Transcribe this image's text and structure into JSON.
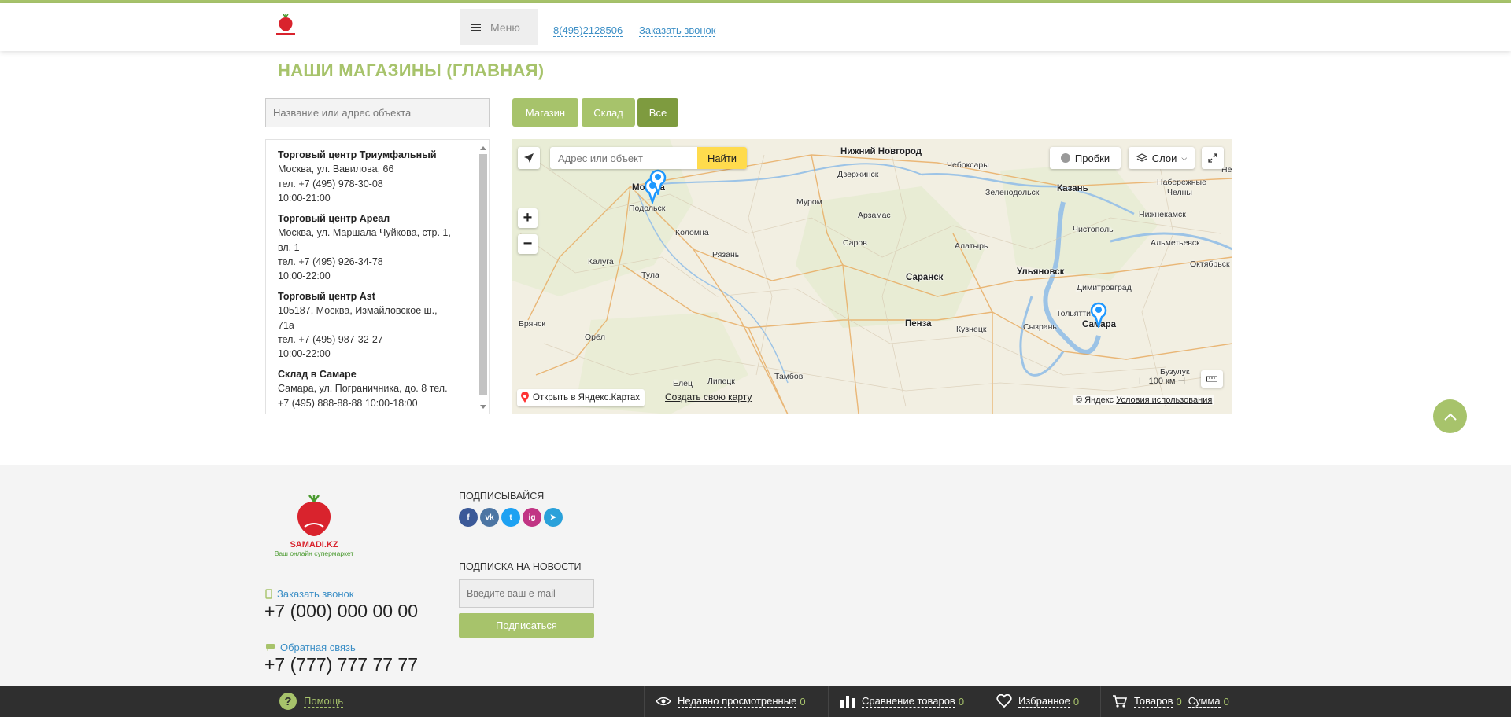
{
  "header": {
    "logo_text": "SAMADI.KZ",
    "menu_label": "Меню",
    "phone": "8(495)2128506",
    "callback": "Заказать звонок"
  },
  "page": {
    "title": "НАШИ МАГАЗИНЫ (ГЛАВНАЯ)",
    "search_placeholder": "Название или адрес объекта",
    "filters": [
      "Магазин",
      "Склад",
      "Все"
    ],
    "active_filter": "Все"
  },
  "stores": [
    {
      "name": "Торговый центр Триумфальный",
      "lines": [
        "Москва, ул. Вавилова, 66",
        "тел. +7 (495) 978-30-08",
        "10:00-21:00"
      ]
    },
    {
      "name": "Торговый центр Ареал",
      "lines": [
        "Москва, ул. Маршала Чуйкова, стр. 1,",
        "вл. 1",
        "тел. +7 (495) 926-34-78",
        "10:00-22:00"
      ]
    },
    {
      "name": "Торговый центр Ast",
      "lines": [
        "105187, Москва, Измайловское ш.,",
        "71а",
        "тел. +7 (495) 987-32-27",
        "10:00-22:00"
      ]
    },
    {
      "name": "Склад в Самаре",
      "lines": [
        "Самара, ул. Пограничника, до. 8 тел.",
        "+7 (495) 888-88-88 10:00-18:00"
      ]
    }
  ],
  "map": {
    "search_placeholder": "Адрес или объект",
    "find_label": "Найти",
    "traffic_label": "Пробки",
    "layers_label": "Слои",
    "open_label": "Открыть в Яндекс.Картах",
    "create_label": "Создать свою карту",
    "copyright": "© Яндекс",
    "terms": "Условия использования",
    "scale": "100 км",
    "cities": [
      {
        "name": "Нижний Новгород",
        "big": true
      },
      {
        "name": "Дзержинск"
      },
      {
        "name": "Чебоксары"
      },
      {
        "name": "Казань",
        "big": true
      },
      {
        "name": "Набережные"
      },
      {
        "name": "Челны"
      },
      {
        "name": "Нижнекамск"
      },
      {
        "name": "Зеленодольск"
      },
      {
        "name": "Муром"
      },
      {
        "name": "Арзамас"
      },
      {
        "name": "Чистополь"
      },
      {
        "name": "Альметьевск"
      },
      {
        "name": "Подольск"
      },
      {
        "name": "Коломна"
      },
      {
        "name": "Саров"
      },
      {
        "name": "Алатырь"
      },
      {
        "name": "Калуга"
      },
      {
        "name": "Рязань"
      },
      {
        "name": "Тула"
      },
      {
        "name": "Саранск",
        "big": true
      },
      {
        "name": "Ульяновск",
        "big": true
      },
      {
        "name": "Октябрьск"
      },
      {
        "name": "Димитровград"
      },
      {
        "name": "Тольятти"
      },
      {
        "name": "Самара",
        "big": true
      },
      {
        "name": "Брянск"
      },
      {
        "name": "Пенза",
        "big": true
      },
      {
        "name": "Кузнецк"
      },
      {
        "name": "Сызрань"
      },
      {
        "name": "Орёл"
      },
      {
        "name": "Елец"
      },
      {
        "name": "Липецк"
      },
      {
        "name": "Тамбов"
      },
      {
        "name": "Москва",
        "big": true
      },
      {
        "name": "Не"
      },
      {
        "name": "Бузулук"
      }
    ]
  },
  "footer": {
    "logo_title": "SAMADI.KZ",
    "logo_subtitle": "Ваш онлайн супермаркет",
    "call_label": "Заказать звонок",
    "phone1": "+7 (000) 000 00 00",
    "feedback_label": "Обратная связь",
    "phone2": "+7 (777) 777 77 77",
    "subscribe_title": "ПОДПИСЫВАЙСЯ",
    "socials": [
      "facebook",
      "vk",
      "twitter",
      "instagram",
      "telegram"
    ],
    "news_title": "ПОДПИСКА НА НОВОСТИ",
    "email_placeholder": "Введите ваш e-mail",
    "subscribe_button": "Подписаться"
  },
  "bottombar": {
    "help": "Помощь",
    "recent_label": "Недавно просмотренные",
    "recent_count": "0",
    "compare_label": "Сравнение товаров",
    "compare_count": "0",
    "favorites_label": "Избранное",
    "favorites_count": "0",
    "cart_label": "Товаров",
    "cart_count": "0",
    "sum_label": "Сумма",
    "sum_count": "0"
  },
  "colors": {
    "accent": "#a7c36b",
    "accent_dark": "#7e9b3f",
    "link": "#3c8fc6",
    "yandex_yellow": "#ffdb4d"
  }
}
